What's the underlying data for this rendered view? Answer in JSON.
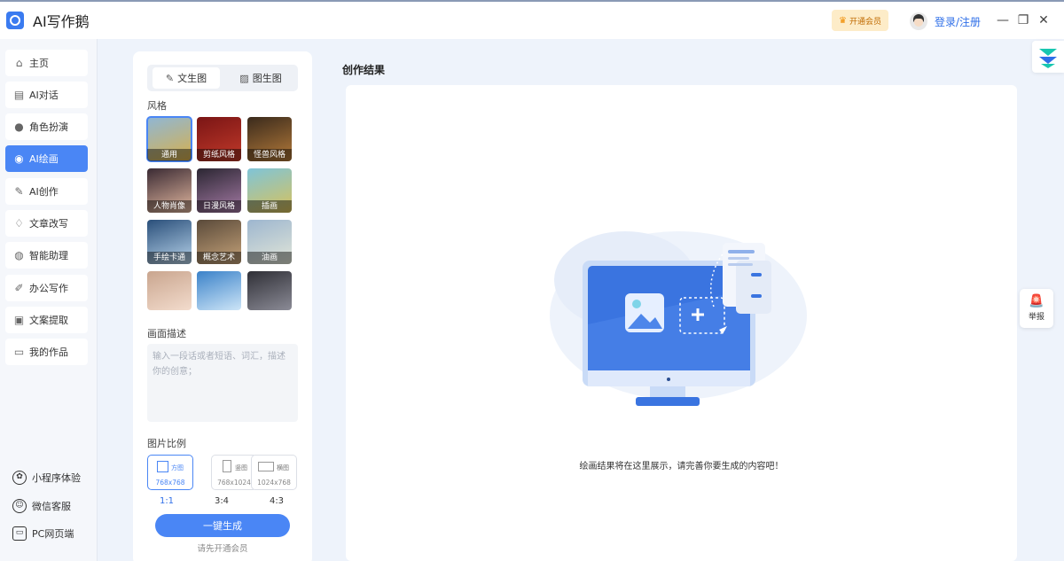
{
  "app": {
    "title": "AI写作鹅"
  },
  "header": {
    "vip_label": "开通会员",
    "login_label": "登录/注册"
  },
  "sidebar": {
    "items": [
      {
        "label": "主页",
        "icon": "home-icon",
        "glyph": "⌂"
      },
      {
        "label": "AI对话",
        "icon": "chat-icon",
        "glyph": "▤"
      },
      {
        "label": "角色扮演",
        "icon": "role-icon",
        "glyph": "●"
      },
      {
        "label": "AI绘画",
        "icon": "palette-icon",
        "glyph": "◉"
      },
      {
        "label": "AI创作",
        "icon": "write-icon",
        "glyph": "✎"
      },
      {
        "label": "文章改写",
        "icon": "bulb-icon",
        "glyph": "♢"
      },
      {
        "label": "智能助理",
        "icon": "assistant-icon",
        "glyph": "◍"
      },
      {
        "label": "办公写作",
        "icon": "edit-icon",
        "glyph": "✐"
      },
      {
        "label": "文案提取",
        "icon": "extract-icon",
        "glyph": "▣"
      },
      {
        "label": "我的作品",
        "icon": "folder-icon",
        "glyph": "▭"
      }
    ],
    "active_index": 3,
    "bottom": [
      {
        "label": "小程序体验",
        "icon": "miniprogram-icon"
      },
      {
        "label": "微信客服",
        "icon": "wechat-service-icon"
      },
      {
        "label": "PC网页端",
        "icon": "pc-web-icon"
      }
    ]
  },
  "panel": {
    "tabs": [
      {
        "label": "文生图",
        "icon": "text-to-image-icon"
      },
      {
        "label": "图生图",
        "icon": "image-to-image-icon"
      }
    ],
    "style_label": "风格",
    "styles": [
      {
        "label": "通用",
        "color1": "#8fb7d6",
        "color2": "#d8b04a"
      },
      {
        "label": "剪纸风格",
        "color1": "#7a1515",
        "color2": "#c23a2a"
      },
      {
        "label": "怪兽风格",
        "color1": "#3a2a1c",
        "color2": "#b57b3a"
      },
      {
        "label": "人物肖像",
        "color1": "#3a2a33",
        "color2": "#e3b8a0"
      },
      {
        "label": "日漫风格",
        "color1": "#2b2632",
        "color2": "#a67ba6"
      },
      {
        "label": "插画",
        "color1": "#7fc4d8",
        "color2": "#d9c25a"
      },
      {
        "label": "手绘卡通",
        "color1": "#2a4f7a",
        "color2": "#b7d3ea"
      },
      {
        "label": "概念艺术",
        "color1": "#5a4a3a",
        "color2": "#c7a47a"
      },
      {
        "label": "油画",
        "color1": "#9db6cf",
        "color2": "#e2e6d8"
      },
      {
        "label": "",
        "color1": "#c9a58e",
        "color2": "#f3dccd"
      },
      {
        "label": "",
        "color1": "#3b82c9",
        "color2": "#cde5f7"
      },
      {
        "label": "",
        "color1": "#2f2f36",
        "color2": "#8b8b96"
      }
    ],
    "desc_label": "画面描述",
    "desc_placeholder": "输入一段话或者短语、词汇，描述你的创意；",
    "ratio_label": "图片比例",
    "ratios": [
      {
        "name": "方图",
        "size": "768x768",
        "ratio": "1:1"
      },
      {
        "name": "竖图",
        "size": "768x1024",
        "ratio": "3:4"
      },
      {
        "name": "横图",
        "size": "1024x768",
        "ratio": "4:3"
      }
    ],
    "generate_label": "一键生成",
    "generate_hint": "请先开通会员"
  },
  "result": {
    "title": "创作结果",
    "empty_message": "绘画结果将在这里展示，请完善你要生成的内容吧！"
  },
  "floating": {
    "report_label": "举报"
  },
  "colors": {
    "accent": "#4a86f5",
    "vip": "#fdecc8",
    "report": "#e8481e"
  }
}
